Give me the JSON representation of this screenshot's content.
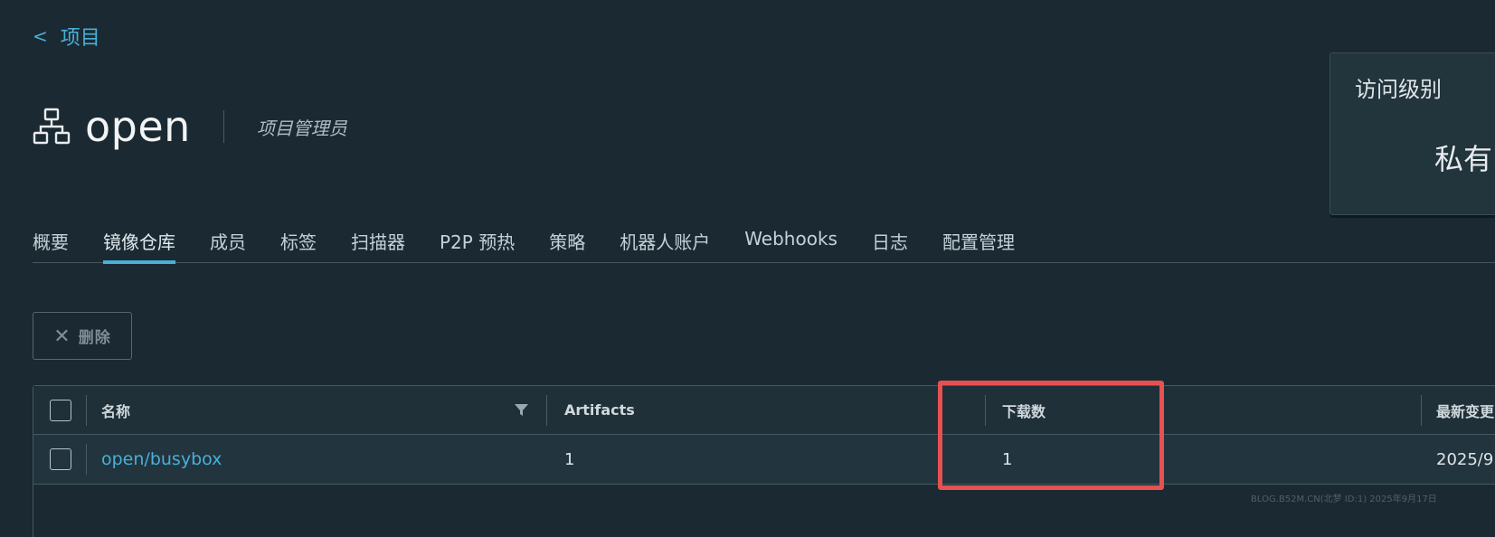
{
  "nav": {
    "back_label": "项目"
  },
  "project": {
    "name": "open",
    "role": "项目管理员"
  },
  "access_card": {
    "title": "访问级别",
    "value": "私有"
  },
  "tabs": [
    {
      "label": "概要"
    },
    {
      "label": "镜像仓库",
      "active": true
    },
    {
      "label": "成员"
    },
    {
      "label": "标签"
    },
    {
      "label": "扫描器"
    },
    {
      "label": "P2P 预热"
    },
    {
      "label": "策略"
    },
    {
      "label": "机器人账户"
    },
    {
      "label": "Webhooks"
    },
    {
      "label": "日志"
    },
    {
      "label": "配置管理"
    }
  ],
  "toolbar": {
    "delete_label": "删除"
  },
  "table": {
    "columns": {
      "name": "名称",
      "artifacts": "Artifacts",
      "pulls": "下载数",
      "updated": "最新变更"
    },
    "rows": [
      {
        "name": "open/busybox",
        "artifacts": "1",
        "pulls": "1",
        "updated": "2025/9"
      }
    ]
  },
  "watermark": "BLOG.B52M.CN(北梦 ID:1) 2025年9月17日",
  "colors": {
    "background": "#1b2a32",
    "accent": "#49afd9",
    "highlight": "#e85151"
  }
}
